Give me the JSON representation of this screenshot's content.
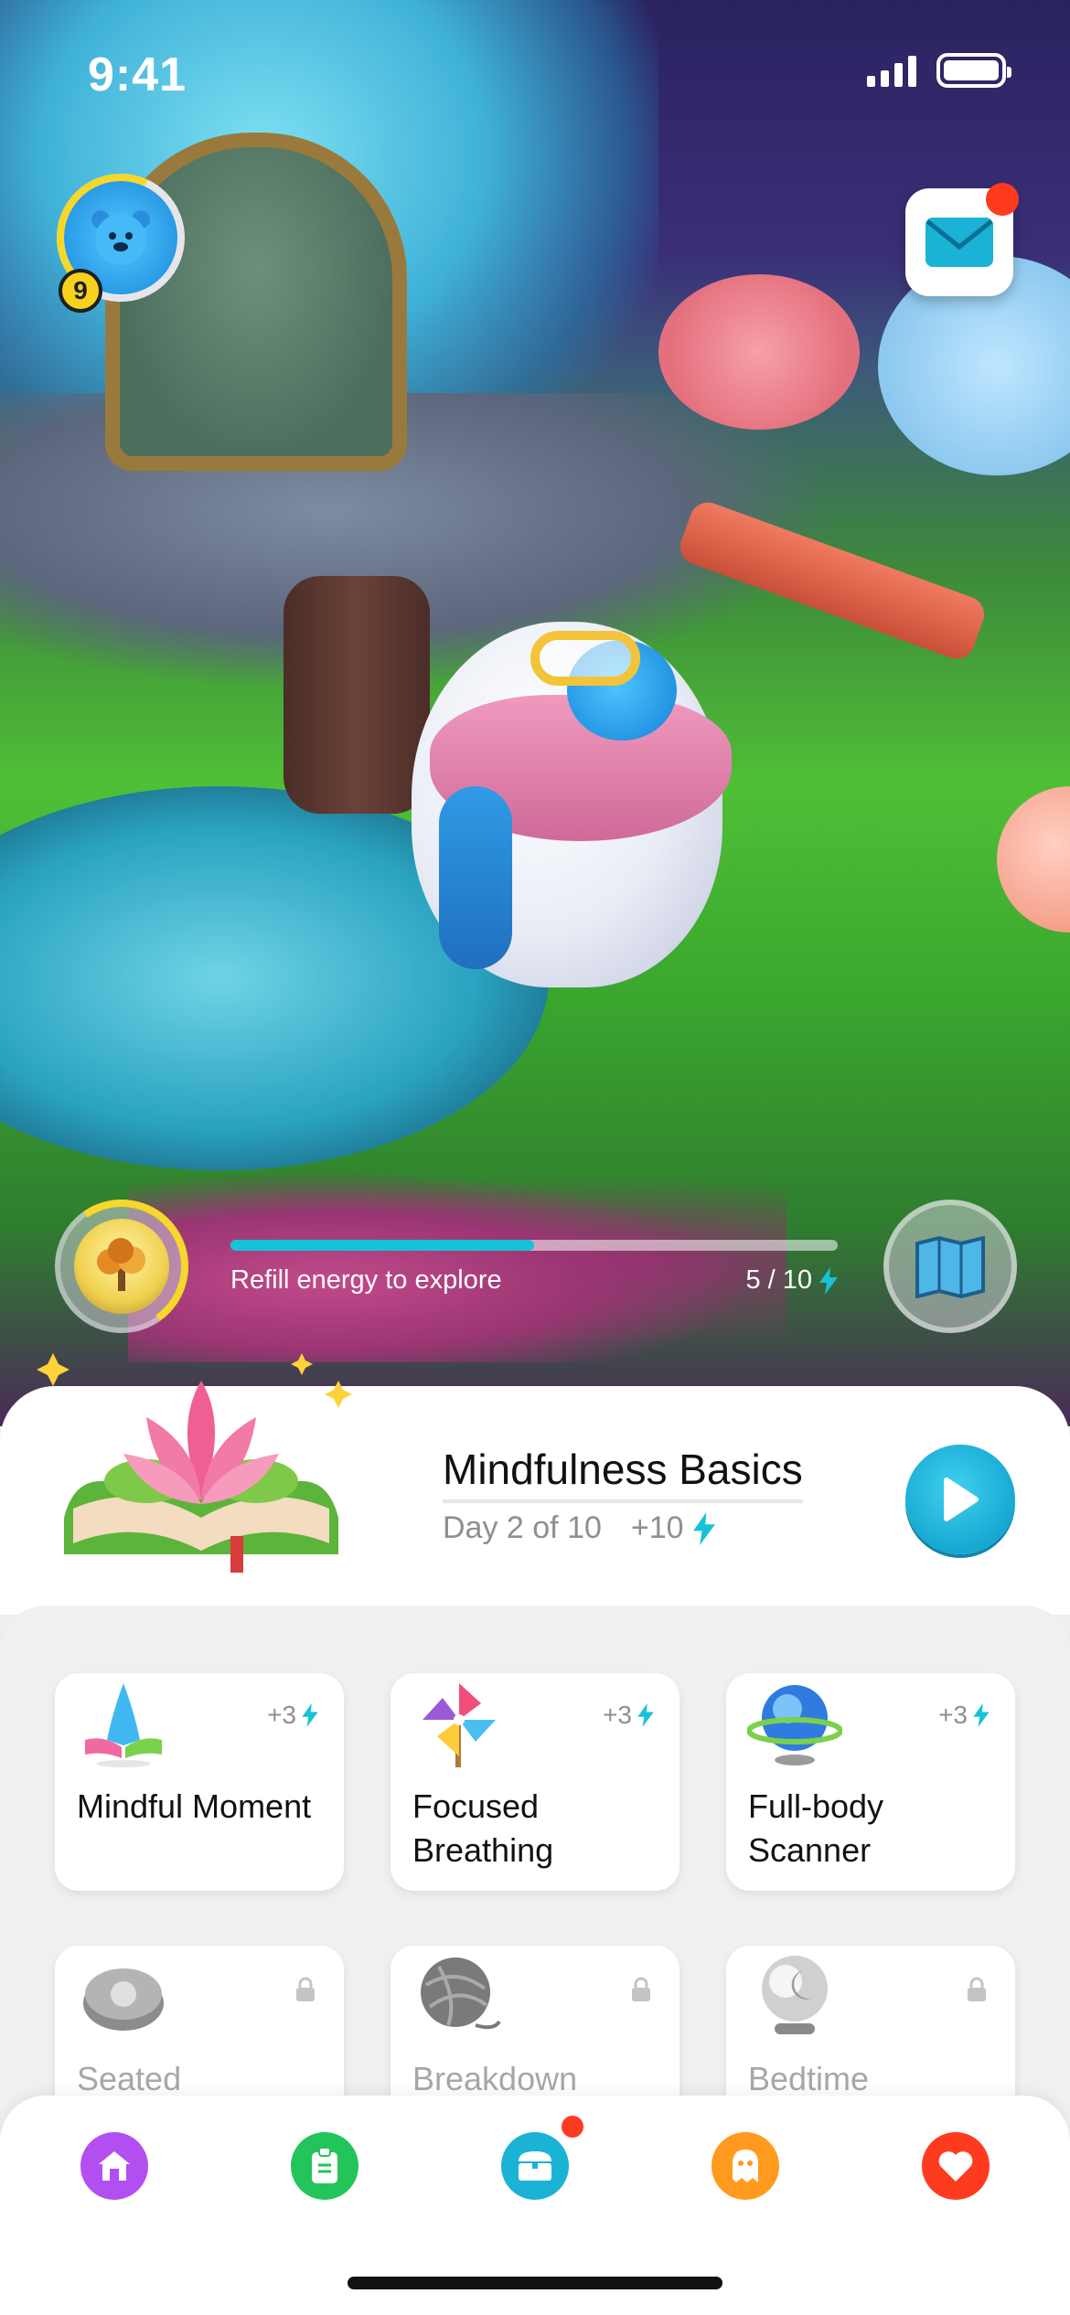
{
  "status_bar": {
    "time": "9:41"
  },
  "profile": {
    "level": "9"
  },
  "energy": {
    "label": "Refill energy to explore",
    "current": 5,
    "max": 10,
    "count_text": "5 / 10"
  },
  "course": {
    "title": "Mindfulness Basics",
    "progress": "Day 2 of 10",
    "reward": "+10"
  },
  "activities": [
    {
      "name": "Mindful Moment",
      "reward": "+3",
      "icon": "praying-hands-icon",
      "locked": false
    },
    {
      "name": "Focused Breathing",
      "reward": "+3",
      "icon": "pinwheel-icon",
      "locked": false
    },
    {
      "name": "Full-body Scanner",
      "reward": "+3",
      "icon": "crystal-orb-icon",
      "locked": false
    },
    {
      "name": "Seated",
      "icon": "cushion-icon",
      "locked": true
    },
    {
      "name": "Breakdown",
      "icon": "yarn-ball-icon",
      "locked": true
    },
    {
      "name": "Bedtime",
      "icon": "moon-globe-icon",
      "locked": true
    }
  ],
  "nav": {
    "items": [
      {
        "name": "home",
        "icon": "home-icon",
        "color": "#b34ff0"
      },
      {
        "name": "journal",
        "icon": "journal-icon",
        "color": "#23c45a"
      },
      {
        "name": "shop",
        "icon": "chest-icon",
        "color": "#1ab3d6"
      },
      {
        "name": "friends",
        "icon": "ghost-icon",
        "color": "#ff9a1f"
      },
      {
        "name": "favorites",
        "icon": "heart-icon",
        "color": "#ff3b1f"
      }
    ]
  },
  "colors": {
    "accent": "#17a8d2",
    "energy_bolt": "#16c3d6",
    "notification": "#ff3b1f"
  }
}
